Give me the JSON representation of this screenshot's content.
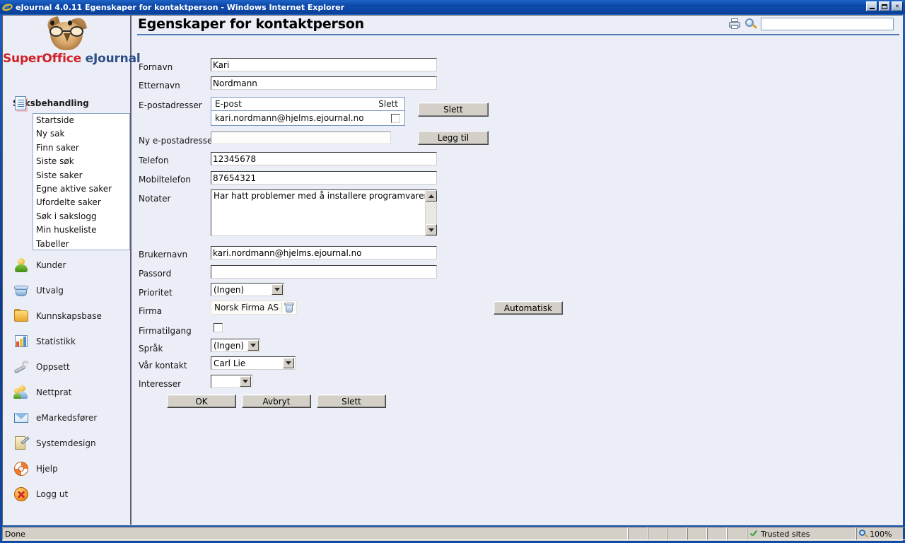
{
  "window": {
    "title": "eJournal 4.0.11 Egenskaper for kontaktperson - Windows Internet Explorer",
    "minimize_label": "_",
    "maximize_label": "□",
    "close_label": "✕"
  },
  "sidebar": {
    "logo": {
      "brand": "SuperOffice",
      "product": "eJournal"
    },
    "modules": [
      {
        "label": "Saksbehandling",
        "icon": "document-icon",
        "active": true
      },
      {
        "label": "Kunder",
        "icon": "person-icon",
        "active": false
      },
      {
        "label": "Utvalg",
        "icon": "basket-icon",
        "active": false
      },
      {
        "label": "Kunnskapsbase",
        "icon": "folder-icon",
        "active": false
      },
      {
        "label": "Statistikk",
        "icon": "bar-chart-icon",
        "active": false
      },
      {
        "label": "Oppsett",
        "icon": "wrench-icon",
        "active": false
      },
      {
        "label": "Nettprat",
        "icon": "people-icon",
        "active": false
      },
      {
        "label": "eMarkedsfører",
        "icon": "envelope-icon",
        "active": false
      },
      {
        "label": "Systemdesign",
        "icon": "design-icon",
        "active": false
      },
      {
        "label": "Hjelp",
        "icon": "lifering-icon",
        "active": false
      },
      {
        "label": "Logg ut",
        "icon": "logout-icon",
        "active": false
      }
    ],
    "submenu": [
      "Startside",
      "Ny sak",
      "Finn saker",
      "Siste søk",
      "Siste saker",
      "Egne aktive saker",
      "Ufordelte saker",
      "Søk i sakslogg",
      "Min huskeliste",
      "Tabeller"
    ]
  },
  "topbar": {
    "heading": "Egenskaper for kontaktperson",
    "print_icon": "printer-icon",
    "search_icon": "search-icon",
    "search_value": "",
    "search_placeholder": ""
  },
  "form": {
    "fornavn": {
      "label": "Fornavn",
      "value": "Kari"
    },
    "etternavn": {
      "label": "Etternavn",
      "value": "Nordmann"
    },
    "epostadresser": {
      "label": "E-postadresser",
      "columns": [
        "E-post",
        "Slett"
      ],
      "rows": [
        {
          "epost": "kari.nordmann@hjelms.ejournal.no",
          "slett_checked": false
        }
      ],
      "delete_button": "Slett"
    },
    "ny_epostadresse": {
      "label": "Ny e-postadresse",
      "value": "",
      "add_button": "Legg til"
    },
    "telefon": {
      "label": "Telefon",
      "value": "12345678"
    },
    "mobiltelefon": {
      "label": "Mobiltelefon",
      "value": "87654321"
    },
    "notater": {
      "label": "Notater",
      "value": "Har hatt problemer med å installere programvaren."
    },
    "brukernavn": {
      "label": "Brukernavn",
      "value": "kari.nordmann@hjelms.ejournal.no"
    },
    "passord": {
      "label": "Passord",
      "value": ""
    },
    "prioritet": {
      "label": "Prioritet",
      "value": "(Ingen)"
    },
    "firma": {
      "label": "Firma",
      "value": "Norsk Firma AS",
      "remove_icon": "bin-icon"
    },
    "firmatilgang": {
      "label": "Firmatilgang",
      "checked": false
    },
    "sprak": {
      "label": "Språk",
      "value": "(Ingen)"
    },
    "var_kontakt": {
      "label": "Vår kontakt",
      "value": "Carl Lie"
    },
    "interesser": {
      "label": "Interesser",
      "value": ""
    },
    "automatisk_button": "Automatisk",
    "ok_button": "OK",
    "avbryt_button": "Avbryt",
    "slett_button": "Slett"
  },
  "statusbar": {
    "status": "Done",
    "zone": "Trusted sites",
    "zone_icon": "green-check-icon",
    "zoom": "100%",
    "zoom_icon": "zoom-icon"
  }
}
